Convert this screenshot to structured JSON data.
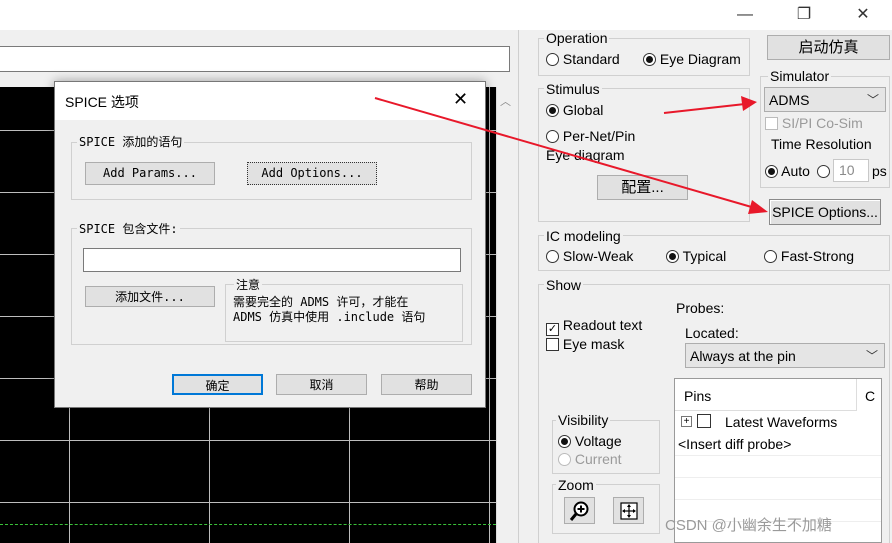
{
  "window": {
    "minimize_glyph": "—",
    "maximize_glyph": "❐",
    "close_glyph": "✕"
  },
  "operation": {
    "label": "Operation",
    "options": [
      "Standard",
      "Eye Diagram"
    ],
    "selected": "Eye Diagram"
  },
  "start_sim_button": "启动仿真",
  "simulator": {
    "label": "Simulator",
    "value": "ADMS",
    "cosim_label": "SI/PI Co-Sim",
    "time_resolution_label": "Time Resolution",
    "auto_label": "Auto",
    "resolution_value": "10",
    "unit": "ps"
  },
  "stimulus": {
    "label": "Stimulus",
    "options": [
      "Global",
      "Per-Net/Pin"
    ],
    "selected": "Global"
  },
  "eye_diagram": {
    "label": "Eye diagram",
    "config_button": "配置..."
  },
  "spice_options_button": "SPICE Options...",
  "ic_modeling": {
    "label": "IC modeling",
    "options": [
      "Slow-Weak",
      "Typical",
      "Fast-Strong"
    ],
    "selected": "Typical"
  },
  "show": {
    "label": "Show",
    "readout_text": "Readout text",
    "eye_mask": "Eye mask",
    "readout_checked": true,
    "eye_mask_checked": false
  },
  "probes": {
    "label": "Probes:",
    "located_label": "Located:",
    "located_value": "Always at the pin",
    "columns": [
      "Pins",
      "C"
    ],
    "tree_item": "Latest Waveforms",
    "expander": "+",
    "insert_item": "<Insert diff probe>"
  },
  "visibility": {
    "label": "Visibility",
    "options": [
      "Voltage",
      "Current"
    ],
    "selected": "Voltage"
  },
  "zoom": {
    "label": "Zoom",
    "zoom_in_icon": "zoom-in",
    "fit_icon": "fit-view"
  },
  "dialog": {
    "title": "SPICE 选项",
    "close_glyph": "✕",
    "statements_group": "SPICE 添加的语句",
    "add_params": "Add Params...",
    "add_options": "Add Options...",
    "include_group": "SPICE 包含文件:",
    "include_value": "",
    "add_file": "添加文件...",
    "note_title": "注意",
    "note_line1": "需要完全的 ADMS 许可，才能在",
    "note_line2": "ADMS 仿真中使用 .include 语句",
    "ok": "确定",
    "cancel": "取消",
    "help": "帮助"
  },
  "watermark": "CSDN @小幽余生不加糖",
  "colors": {
    "scope_bg": "#000000",
    "grid": "#bdbdbd",
    "zero_line": "#39c239",
    "annotation_arrow": "#e8182a"
  }
}
